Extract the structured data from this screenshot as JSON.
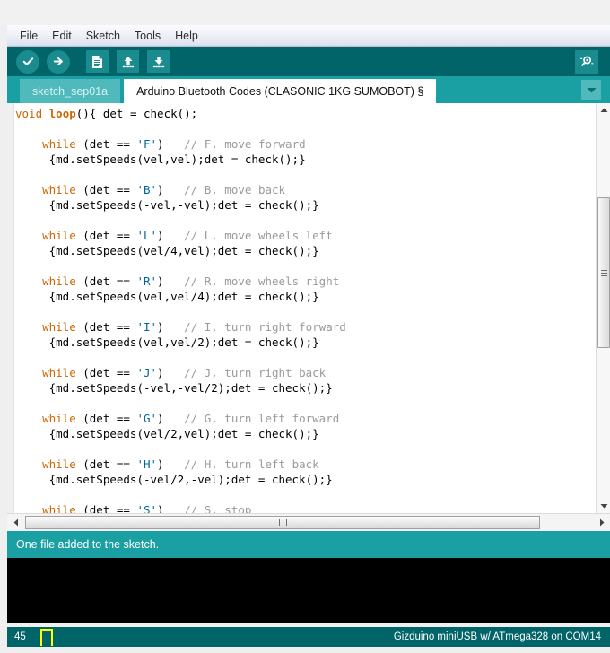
{
  "menubar": {
    "items": [
      {
        "label": "File"
      },
      {
        "label": "Edit"
      },
      {
        "label": "Sketch"
      },
      {
        "label": "Tools"
      },
      {
        "label": "Help"
      }
    ]
  },
  "toolbar": {
    "verify_icon": "check-icon",
    "upload_icon": "arrow-right-icon",
    "new_icon": "new-file-icon",
    "open_icon": "arrow-up-icon",
    "save_icon": "arrow-down-icon",
    "serial_monitor_icon": "magnifier-icon",
    "background_color": "#006468",
    "button_color": "#1a8b8f"
  },
  "tabbar": {
    "tabs": [
      {
        "label": "sketch_sep01a",
        "active": false
      },
      {
        "label": "Arduino Bluetooth Codes (CLASONIC 1KG SUMOBOT) §",
        "active": true
      }
    ],
    "menu_icon": "chevron-down-icon",
    "background_color": "#1a9fa3"
  },
  "editor": {
    "lines": [
      {
        "tokens": [
          {
            "t": "void ",
            "c": "kw"
          },
          {
            "t": "loop",
            "c": "fn"
          },
          {
            "t": "(){ det = check();",
            "c": ""
          }
        ]
      },
      {
        "tokens": []
      },
      {
        "tokens": [
          {
            "t": "    while",
            "c": "kw"
          },
          {
            "t": " (det == ",
            "c": ""
          },
          {
            "t": "'F'",
            "c": "ch"
          },
          {
            "t": ")   ",
            "c": ""
          },
          {
            "t": "// F, move forward",
            "c": "cm"
          }
        ]
      },
      {
        "tokens": [
          {
            "t": "     {md.setSpeeds(vel,vel);det = check();}",
            "c": ""
          }
        ]
      },
      {
        "tokens": []
      },
      {
        "tokens": [
          {
            "t": "    while",
            "c": "kw"
          },
          {
            "t": " (det == ",
            "c": ""
          },
          {
            "t": "'B'",
            "c": "ch"
          },
          {
            "t": ")   ",
            "c": ""
          },
          {
            "t": "// B, move back",
            "c": "cm"
          }
        ]
      },
      {
        "tokens": [
          {
            "t": "     {md.setSpeeds(-vel,-vel);det = check();}",
            "c": ""
          }
        ]
      },
      {
        "tokens": []
      },
      {
        "tokens": [
          {
            "t": "    while",
            "c": "kw"
          },
          {
            "t": " (det == ",
            "c": ""
          },
          {
            "t": "'L'",
            "c": "ch"
          },
          {
            "t": ")   ",
            "c": ""
          },
          {
            "t": "// L, move wheels left",
            "c": "cm"
          }
        ]
      },
      {
        "tokens": [
          {
            "t": "     {md.setSpeeds(vel/4,vel);det = check();}",
            "c": ""
          }
        ]
      },
      {
        "tokens": []
      },
      {
        "tokens": [
          {
            "t": "    while",
            "c": "kw"
          },
          {
            "t": " (det == ",
            "c": ""
          },
          {
            "t": "'R'",
            "c": "ch"
          },
          {
            "t": ")   ",
            "c": ""
          },
          {
            "t": "// R, move wheels right",
            "c": "cm"
          }
        ]
      },
      {
        "tokens": [
          {
            "t": "     {md.setSpeeds(vel,vel/4);det = check();}",
            "c": ""
          }
        ]
      },
      {
        "tokens": []
      },
      {
        "tokens": [
          {
            "t": "    while",
            "c": "kw"
          },
          {
            "t": " (det == ",
            "c": ""
          },
          {
            "t": "'I'",
            "c": "ch"
          },
          {
            "t": ")   ",
            "c": ""
          },
          {
            "t": "// I, turn right forward",
            "c": "cm"
          }
        ]
      },
      {
        "tokens": [
          {
            "t": "     {md.setSpeeds(vel,vel/2);det = check();}",
            "c": ""
          }
        ]
      },
      {
        "tokens": []
      },
      {
        "tokens": [
          {
            "t": "    while",
            "c": "kw"
          },
          {
            "t": " (det == ",
            "c": ""
          },
          {
            "t": "'J'",
            "c": "ch"
          },
          {
            "t": ")   ",
            "c": ""
          },
          {
            "t": "// J, turn right back",
            "c": "cm"
          }
        ]
      },
      {
        "tokens": [
          {
            "t": "     {md.setSpeeds(-vel,-vel/2);det = check();}",
            "c": ""
          }
        ]
      },
      {
        "tokens": []
      },
      {
        "tokens": [
          {
            "t": "    while",
            "c": "kw"
          },
          {
            "t": " (det == ",
            "c": ""
          },
          {
            "t": "'G'",
            "c": "ch"
          },
          {
            "t": ")   ",
            "c": ""
          },
          {
            "t": "// G, turn left forward",
            "c": "cm"
          }
        ]
      },
      {
        "tokens": [
          {
            "t": "     {md.setSpeeds(vel/2,vel);det = check();}",
            "c": ""
          }
        ]
      },
      {
        "tokens": []
      },
      {
        "tokens": [
          {
            "t": "    while",
            "c": "kw"
          },
          {
            "t": " (det == ",
            "c": ""
          },
          {
            "t": "'H'",
            "c": "ch"
          },
          {
            "t": ")   ",
            "c": ""
          },
          {
            "t": "// H, turn left back",
            "c": "cm"
          }
        ]
      },
      {
        "tokens": [
          {
            "t": "     {md.setSpeeds(-vel/2,-vel);det = check();}",
            "c": ""
          }
        ]
      },
      {
        "tokens": []
      },
      {
        "tokens": [
          {
            "t": "    while",
            "c": "kw"
          },
          {
            "t": " (det == ",
            "c": ""
          },
          {
            "t": "'S'",
            "c": "ch"
          },
          {
            "t": ")   ",
            "c": ""
          },
          {
            "t": "// S, stop",
            "c": "cm"
          }
        ]
      }
    ],
    "colors": {
      "keyword": "#cc6600",
      "char_literal": "#006699",
      "comment": "#9a9a9a",
      "text": "#000000",
      "background": "#ffffff"
    }
  },
  "scrollbars": {
    "vertical_up_icon": "triangle-up-icon",
    "vertical_down_icon": "triangle-down-icon",
    "horizontal_left_icon": "triangle-left-icon",
    "horizontal_right_icon": "triangle-right-icon"
  },
  "status": {
    "message": "One file added to the sketch.",
    "background_color": "#1a9fa3"
  },
  "console": {
    "text": "",
    "background_color": "#000000"
  },
  "bottombar": {
    "line_number": "45",
    "board_info": "Gizduino miniUSB w/ ATmega328 on COM14",
    "background_color": "#006468",
    "activity_color": "#ffff00"
  }
}
